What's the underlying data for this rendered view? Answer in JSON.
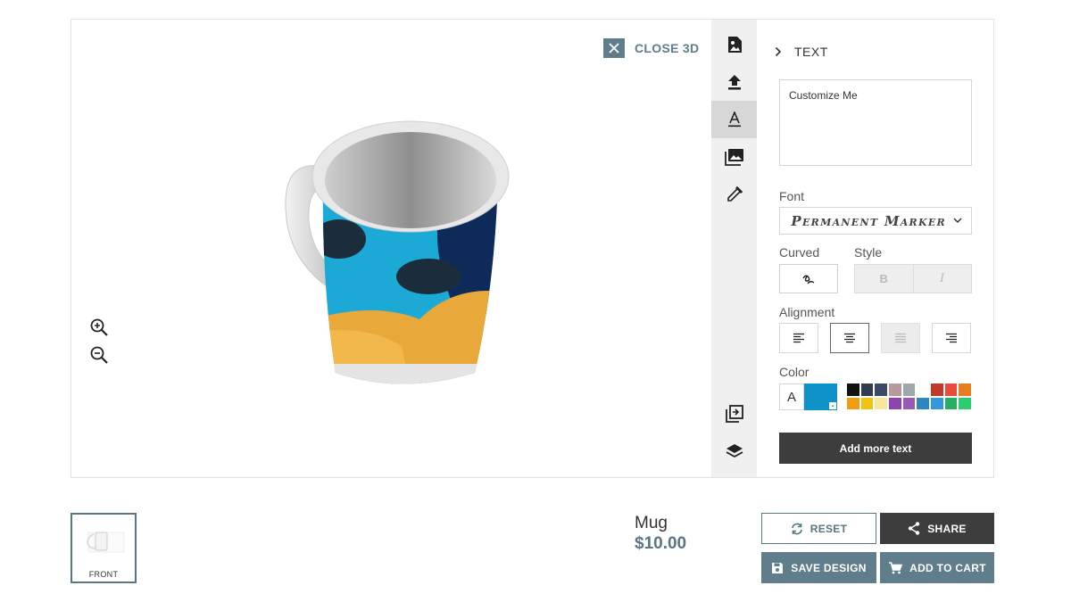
{
  "viewer": {
    "close_label": "CLOSE 3D",
    "icons": [
      "close-icon",
      "zoom-in-icon",
      "zoom-out-icon"
    ]
  },
  "toolbar": {
    "tools": [
      "image-icon",
      "upload-icon",
      "text-icon",
      "gallery-icon",
      "eyedropper-icon",
      "copy-to-side-icon",
      "layers-icon"
    ],
    "active": "text-icon"
  },
  "panel": {
    "title": "TEXT",
    "text_value": "Customize Me",
    "font_label": "Font",
    "font_value": "Permanent Marker",
    "curved_label": "Curved",
    "style_label": "Style",
    "bold_label": "B",
    "italic_label": "I",
    "alignment_label": "Alignment",
    "alignment_selected": "center",
    "color_label": "Color",
    "color_a": "A",
    "selected_color": "#0e92c8",
    "palette": [
      "#111111",
      "#2f3d4f",
      "#3a4a66",
      "#b79a9c",
      "#9ea8ab",
      "#ffffff",
      "#c0392b",
      "#e74c3c",
      "#e67e22",
      "#f39c12",
      "#f1c40f",
      "#f5e6a0",
      "#8e44ad",
      "#9b59b6",
      "#2e86c1",
      "#3498db",
      "#27ae60",
      "#2ecc71"
    ],
    "add_text_label": "Add more text"
  },
  "footer": {
    "thumb_label": "FRONT",
    "product_name": "Mug",
    "product_price": "$10.00",
    "reset_label": "RESET",
    "share_label": "SHARE",
    "save_label": "SAVE DESIGN",
    "cart_label": "ADD TO CART"
  }
}
